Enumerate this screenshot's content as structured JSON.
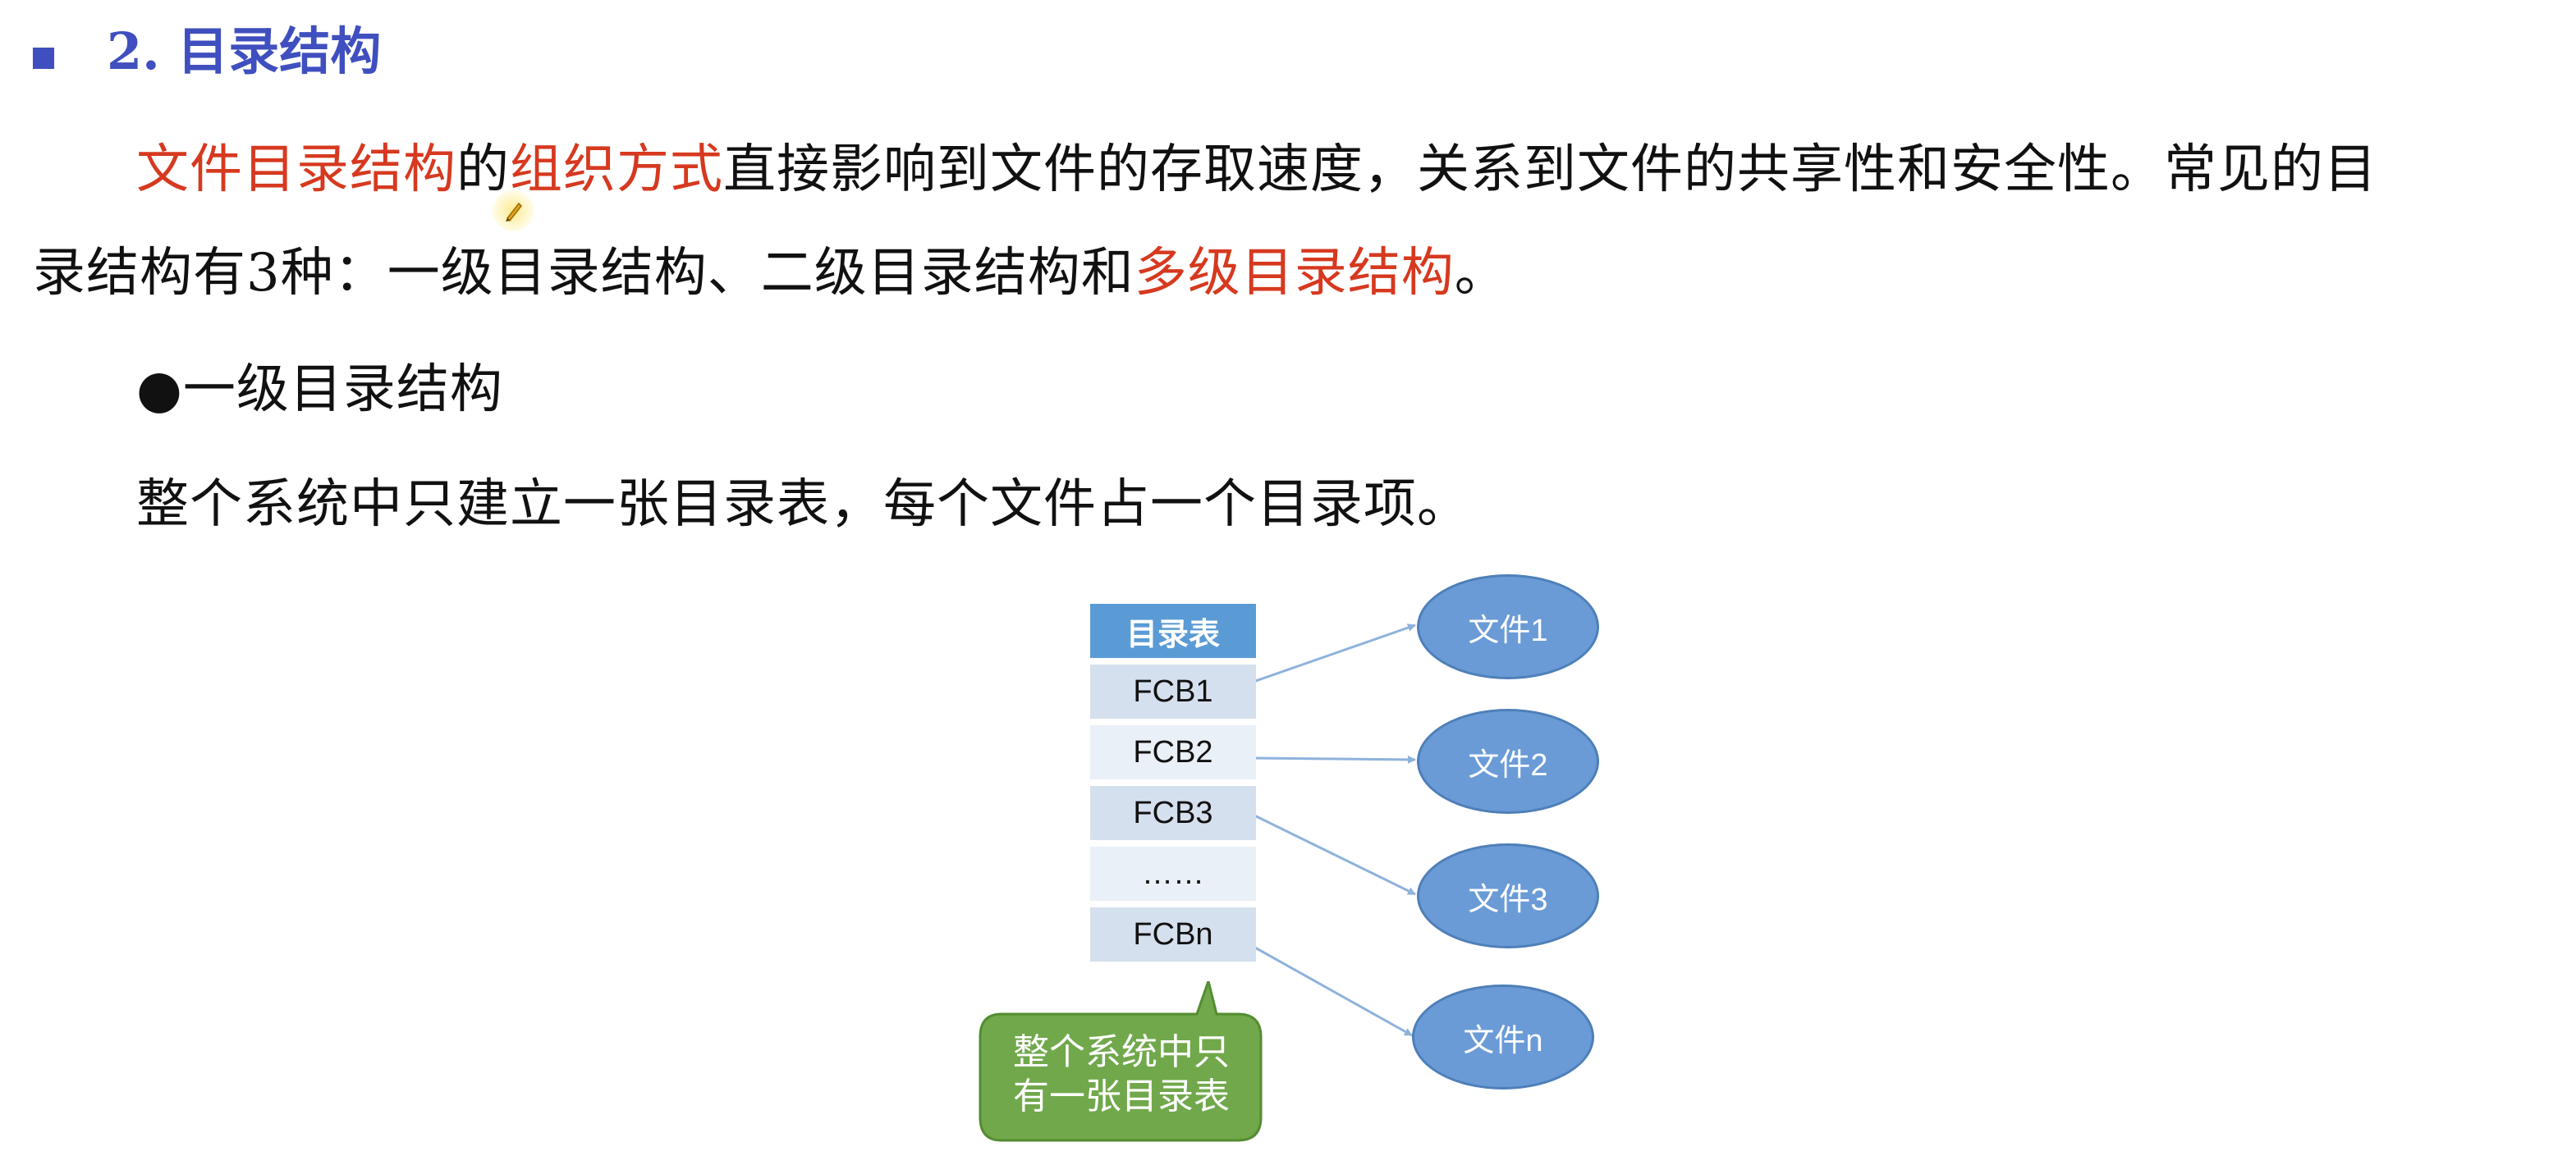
{
  "heading": {
    "text": "2. 目录结构"
  },
  "paragraph1": {
    "line1": {
      "red1": "文件目录结构",
      "plain1": "的",
      "red2": "组织方式",
      "plain2": "直接影响到文件的存取速度，关系到文件的共享性和安全性。常见的目"
    },
    "line2": {
      "plain1": "录结构有3种：一级目录结构、二级目录结构和",
      "red1": "多级目录结构",
      "plain2": "。"
    }
  },
  "bullet": {
    "symbol": "●",
    "text": "一级目录结构"
  },
  "paragraph2": {
    "text": "整个系统中只建立一张目录表，每个文件占一个目录项。"
  },
  "diagram": {
    "table_header": "目录表",
    "rows": [
      "FCB1",
      "FCB2",
      "FCB3",
      "……",
      "FCBn"
    ],
    "files": [
      "文件1",
      "文件2",
      "文件3",
      "文件n"
    ],
    "callout": {
      "line1": "整个系统中只",
      "line2": "有一张目录表"
    },
    "colors": {
      "header_fill": "#5b9bd5",
      "row_fill_a": "#d5e0ee",
      "row_fill_b": "#eaf0f7",
      "file_fill": "#6a9bd6",
      "callout_fill": "#70a84b",
      "arrow": "#8fb2dc"
    }
  },
  "colors": {
    "heading": "#3f4fbf",
    "emphasis": "#d6391f"
  }
}
